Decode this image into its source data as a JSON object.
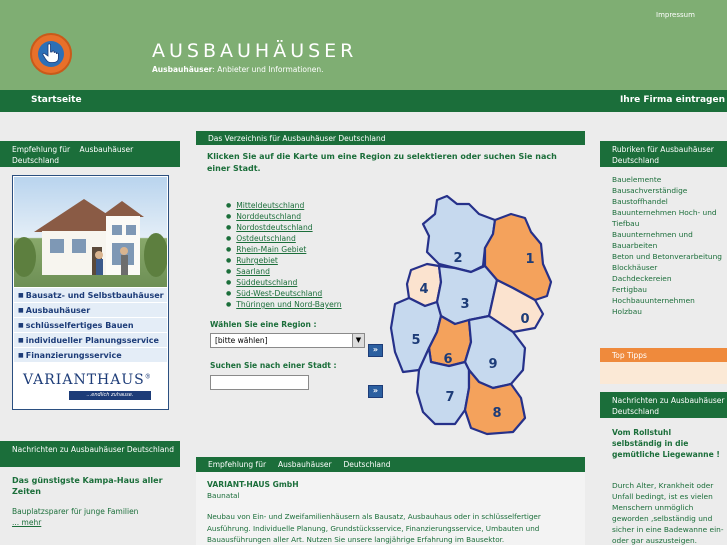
{
  "header": {
    "title": "AUSBAUHÄUSER",
    "subtitle_bold": "Ausbauhäuser",
    "subtitle_rest": ": Anbieter und Informationen.",
    "impressum": "Impressum",
    "logo_icon": "hand-pointer-icon"
  },
  "nav": {
    "start": "Startseite",
    "firma": "Ihre Firma eintragen"
  },
  "left": {
    "ad_box_title": "Empfehlung für    Ausbauhäuser Deutschland",
    "ad_items": [
      "Bausatz- und Selbstbauhäuser",
      "Ausbauhäuser",
      "schlüsselfertiges Bauen",
      "individueller Planungsservice",
      "Finanzierungsservice"
    ],
    "ad_logo": "VARIANTHAUS",
    "ad_logo_reg": "®",
    "ad_logo_sub": "...endlich zuhause.",
    "news_box_title": "Nachrichten zu Ausbauhäuser Deutschland",
    "news_title": "Das günstigste Kampa-Haus aller Zeiten",
    "news_text": "Bauplatzsparer für junge Familien",
    "news_more": "... mehr"
  },
  "center": {
    "box_title": "Das Verzeichnis für Ausbauhäuser Deutschland",
    "intro": "Klicken Sie auf die Karte um eine Region zu selektieren oder suchen Sie nach einer Stadt.",
    "regions": [
      "Mitteldeutschland",
      "Norddeutschland",
      "Nordostdeutschland",
      "Ostdeutschland",
      "Rhein-Main Gebiet",
      "Ruhrgebiet",
      "Saarland",
      "Süddeutschland",
      "Süd-West-Deutschland",
      "Thüringen und Nord-Bayern"
    ],
    "region_label": "Wählen Sie eine Region :",
    "region_select_value": "[bitte wählen]",
    "city_label": "Suchen Sie nach einer Stadt :",
    "city_value": "",
    "go_label": "»",
    "map_regions": [
      "1",
      "2",
      "3",
      "4",
      "5",
      "6",
      "7",
      "8",
      "9",
      "0"
    ],
    "recommend_title": "Empfehlung für     Ausbauhäuser     Deutschland",
    "company_name": "VARIANT-HAUS GmbH",
    "company_city": "Baunatal",
    "company_text": "Neubau von Ein- und Zweifamilienhäusern als Bausatz, Ausbauhaus oder in schlüsselfertiger Ausführung. Individuelle Planung, Grundstücksservice, Finanzierungsservice, Umbauten und Bauausführungen aller Art. Nutzen Sie unsere langjährige Erfahrung im Bausektor."
  },
  "right": {
    "rubriken_title": "Rubriken für Ausbauhäuser Deutschland",
    "rubriken": [
      "Bauelemente",
      "Bausachverständige",
      "Baustoffhandel",
      "Bauunternehmen Hoch- und Tiefbau",
      "Bauunternehmen und Bauarbeiten",
      "Beton und Betonverarbeitung",
      "Blockhäuser",
      "Dachdeckereien",
      "Fertigbau",
      "Hochbauunternehmen",
      "Holzbau"
    ],
    "tipps_title": "Top Tipps",
    "news_box_title": "Nachrichten zu Ausbauhäuser Deutschland",
    "news_title": "Vom Rollstuhl selbständig in die gemütliche Liegewanne !",
    "news_text": "Durch Alter, Krankheit oder Unfall bedingt, ist es vielen Menschern unmöglich geworden ,selbständig und sicher in eine Badewanne ein-oder gar auszusteigen."
  },
  "colors": {
    "header_green": "#7fae73",
    "dark_green": "#1b6e3a",
    "orange": "#ef8a3c",
    "light_blue": "#c6d9ee",
    "map_orange": "#f4a25c"
  }
}
